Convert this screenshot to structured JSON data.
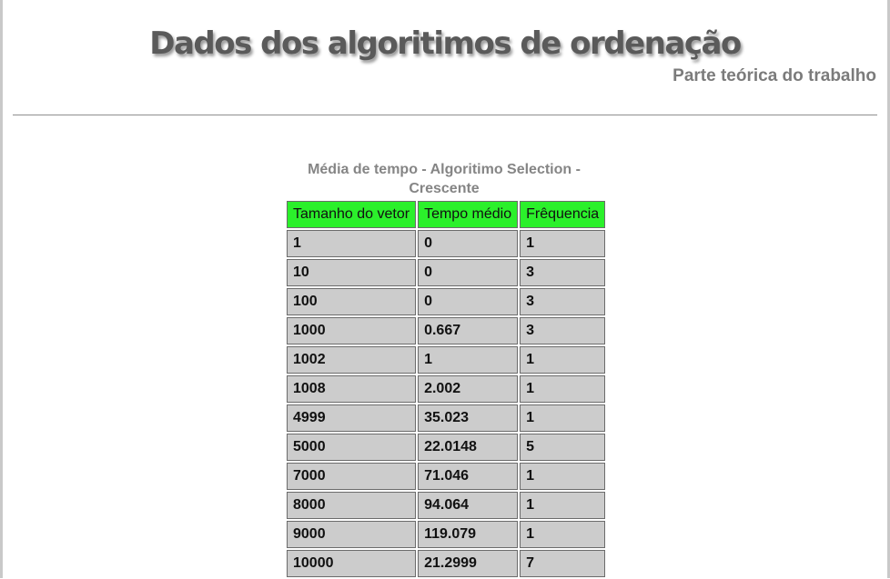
{
  "header": {
    "title": "Dados dos algoritimos de ordenação",
    "subtitle": "Parte teórica do trabalho"
  },
  "table": {
    "caption": "Média de tempo - Algoritimo Selection - Crescente",
    "columns": [
      "Tamanho do vetor",
      "Tempo médio",
      "Frêquencia"
    ],
    "rows": [
      [
        "1",
        "0",
        "1"
      ],
      [
        "10",
        "0",
        "3"
      ],
      [
        "100",
        "0",
        "3"
      ],
      [
        "1000",
        "0.667",
        "3"
      ],
      [
        "1002",
        "1",
        "1"
      ],
      [
        "1008",
        "2.002",
        "1"
      ],
      [
        "4999",
        "35.023",
        "1"
      ],
      [
        "5000",
        "22.0148",
        "5"
      ],
      [
        "7000",
        "71.046",
        "1"
      ],
      [
        "8000",
        "94.064",
        "1"
      ],
      [
        "9000",
        "119.079",
        "1"
      ],
      [
        "10000",
        "21.2999",
        "7"
      ]
    ],
    "colors": {
      "header_bg": "#2bf02b",
      "cell_bg": "#cccccc"
    }
  }
}
